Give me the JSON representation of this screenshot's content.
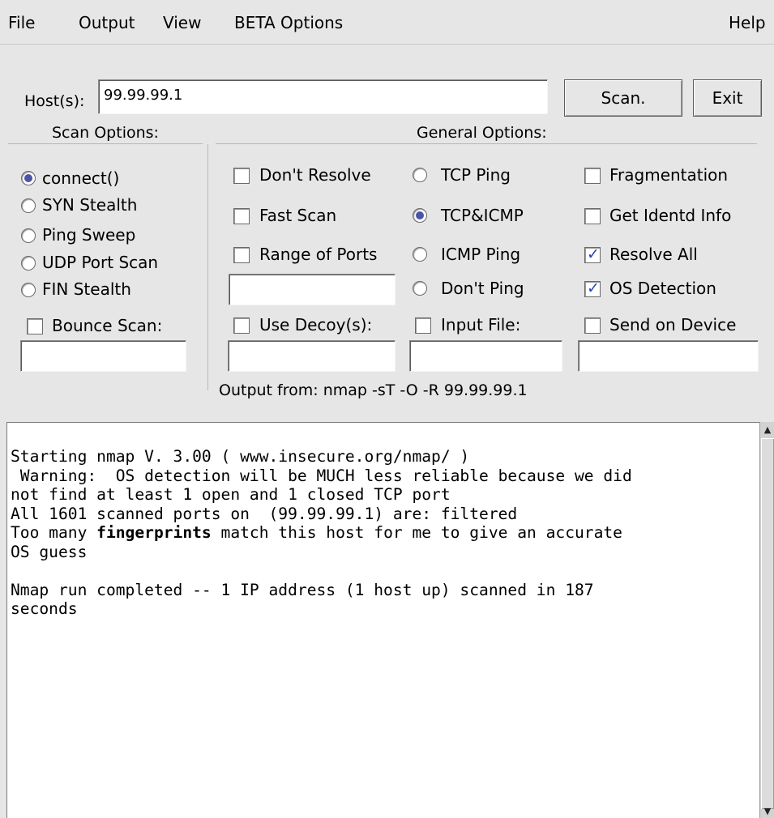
{
  "menu": {
    "file": "File",
    "output": "Output",
    "view": "View",
    "beta": "BETA Options",
    "help": "Help"
  },
  "host": {
    "label": "Host(s):",
    "value": "99.99.99.1",
    "scan_button": "Scan.",
    "exit_button": "Exit"
  },
  "scan_options": {
    "heading": "Scan Options:",
    "selected": "connect()",
    "items": [
      "connect()",
      "SYN Stealth",
      "Ping Sweep",
      "UDP Port Scan",
      "FIN Stealth"
    ],
    "bounce_label": "Bounce Scan:",
    "bounce_checked": false,
    "bounce_value": ""
  },
  "general_options": {
    "heading": "General Options:",
    "col1": [
      {
        "label": "Don't Resolve",
        "checked": false
      },
      {
        "label": "Fast Scan",
        "checked": false
      },
      {
        "label": "Range of Ports",
        "checked": false
      }
    ],
    "range_value": "",
    "decoy_label": "Use Decoy(s):",
    "decoy_checked": false,
    "decoy_value": "",
    "ping_selected": "TCP&ICMP",
    "ping": [
      "TCP Ping",
      "TCP&ICMP",
      "ICMP Ping",
      "Don't Ping"
    ],
    "input_file_label": "Input File:",
    "input_file_checked": false,
    "input_file_value": "",
    "col3": [
      {
        "label": "Fragmentation",
        "checked": false
      },
      {
        "label": "Get Identd Info",
        "checked": false
      },
      {
        "label": "Resolve All",
        "checked": true
      },
      {
        "label": "OS Detection",
        "checked": true
      }
    ],
    "send_device_label": "Send on Device",
    "send_device_checked": false,
    "send_device_value": ""
  },
  "output_from": "Output from: nmap -sT -O -R 99.99.99.1",
  "output": {
    "line1": "Starting nmap V. 3.00 ( www.insecure.org/nmap/ )",
    "line2": " Warning:  OS detection will be MUCH less reliable because we did",
    "line3": "not find at least 1 open and 1 closed TCP port",
    "line4": "All 1601 scanned ports on  (99.99.99.1) are: filtered",
    "line5_pre": "Too many ",
    "line5_bold": "fingerprints",
    "line5_post": " match this host for me to give an accurate",
    "line6": "OS guess",
    "line7": "",
    "line8": "Nmap run completed -- 1 IP address (1 host up) scanned in 187",
    "line9": "seconds"
  },
  "colors": {
    "window_bg": "#e6e6e6",
    "radio_fill": "#4a55a8",
    "check_mark": "#2a44b8"
  },
  "icons": {
    "scroll_up": "scroll-up-arrow-icon",
    "scroll_down": "scroll-down-arrow-icon"
  }
}
